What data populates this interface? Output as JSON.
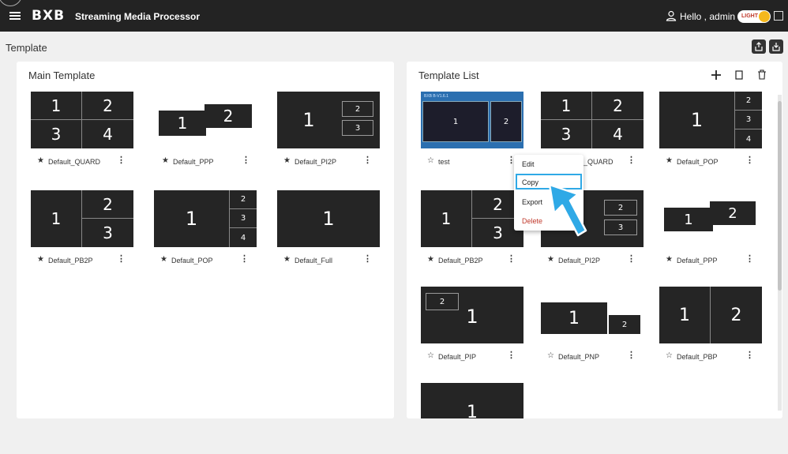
{
  "topbar": {
    "brand": "BXB",
    "title": "Streaming Media Processor",
    "greeting": "Hello , admin",
    "theme_label": "LIGHT"
  },
  "page": {
    "title": "Template"
  },
  "main_panel": {
    "title": "Main Template",
    "cards": [
      {
        "name": "Default_QUARD",
        "zones": [
          "1",
          "2",
          "3",
          "4"
        ]
      },
      {
        "name": "Default_PPP",
        "zones": [
          "1",
          "2"
        ]
      },
      {
        "name": "Default_PI2P",
        "zones": [
          "1",
          "2",
          "3"
        ]
      },
      {
        "name": "Default_PB2P",
        "zones": [
          "1",
          "2",
          "3"
        ]
      },
      {
        "name": "Default_POP",
        "zones": [
          "1",
          "2",
          "3",
          "4"
        ]
      },
      {
        "name": "Default_Full",
        "zones": [
          "1"
        ]
      }
    ]
  },
  "list_panel": {
    "title": "Template List",
    "cards": [
      {
        "name": "test",
        "zones": [
          "1",
          "2"
        ],
        "banner": "BXB B-V1.6.1"
      },
      {
        "name": "Default_QUARD",
        "display_name": "_QUARD",
        "zones": [
          "1",
          "2",
          "3",
          "4"
        ]
      },
      {
        "name": "Default_POP",
        "zones": [
          "1",
          "2",
          "3",
          "4"
        ]
      },
      {
        "name": "Default_PB2P",
        "zones": [
          "1",
          "2",
          "3"
        ]
      },
      {
        "name": "Default_PI2P",
        "zones": [
          "1",
          "2",
          "3"
        ]
      },
      {
        "name": "Default_PPP",
        "zones": [
          "1",
          "2"
        ]
      },
      {
        "name": "Default_PIP",
        "zones": [
          "2",
          "1"
        ]
      },
      {
        "name": "Default_PNP",
        "zones": [
          "1",
          "2"
        ]
      },
      {
        "name": "Default_PBP",
        "zones": [
          "1",
          "2"
        ]
      },
      {
        "name": "",
        "zones": [
          "1"
        ]
      }
    ]
  },
  "context_menu": {
    "items": [
      "Edit",
      "Copy",
      "Export",
      "Delete"
    ],
    "highlighted": "Copy",
    "delete_color": "#c0392b"
  },
  "colors": {
    "topbar": "#232323",
    "accent": "#2fa9e6",
    "toggle_knob": "#f5b81c"
  },
  "icons": [
    "menu-icon",
    "user-icon",
    "fullscreen-icon",
    "export-icon",
    "import-icon",
    "plus-icon",
    "copy-icon",
    "trash-icon",
    "star-icon",
    "star-outline-icon",
    "more-vertical-icon",
    "cursor-arrow-icon"
  ]
}
